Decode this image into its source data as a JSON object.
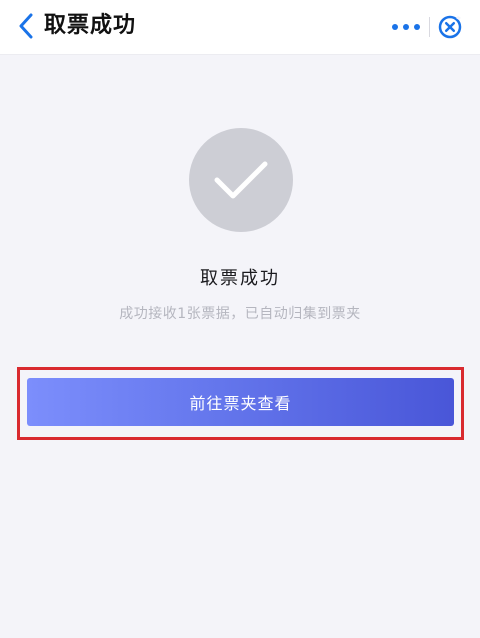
{
  "header": {
    "title": "取票成功",
    "back_icon": "chevron-left-icon",
    "more_icon": "more-dots-icon",
    "close_icon": "circle-close-icon"
  },
  "result": {
    "icon": "check-icon",
    "title": "取票成功",
    "subtitle": "成功接收1张票据，已自动归集到票夹"
  },
  "actions": {
    "primary_label": "前往票夹查看"
  },
  "colors": {
    "accent": "#1a73e8",
    "button_gradient_start": "#7c8efc",
    "button_gradient_end": "#4956d8",
    "highlight_border": "#d92a2f",
    "check_circle": "#cdced5"
  }
}
